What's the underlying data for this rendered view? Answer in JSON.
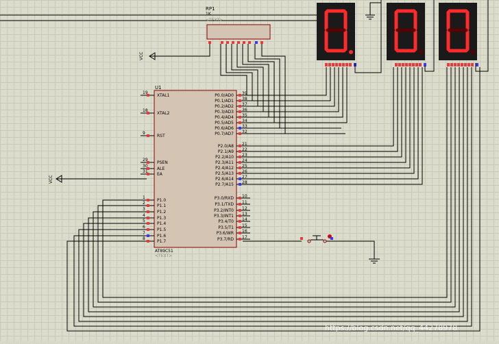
{
  "resistor_pack": {
    "ref": "RP1",
    "value": "1K",
    "text_tag": "<TEXT>"
  },
  "mcu": {
    "ref": "U1",
    "part": "AT89C51",
    "text_tag": "<TEXT>",
    "left_pins": [
      {
        "num": "19",
        "name": "XTAL1"
      },
      {
        "num": "18",
        "name": "XTAL2"
      },
      {
        "num": "9",
        "name": "RST"
      },
      {
        "num": "29",
        "name": "PSEN"
      },
      {
        "num": "30",
        "name": "ALE"
      },
      {
        "num": "31",
        "name": "EA"
      },
      {
        "num": "1",
        "name": "P1.0"
      },
      {
        "num": "2",
        "name": "P1.1"
      },
      {
        "num": "3",
        "name": "P1.2"
      },
      {
        "num": "4",
        "name": "P1.3"
      },
      {
        "num": "5",
        "name": "P1.4"
      },
      {
        "num": "6",
        "name": "P1.5"
      },
      {
        "num": "7",
        "name": "P1.6"
      },
      {
        "num": "8",
        "name": "P1.7"
      }
    ],
    "right_pins_p0": [
      {
        "num": "39",
        "name": "P0.0/AD0"
      },
      {
        "num": "38",
        "name": "P0.1/AD1"
      },
      {
        "num": "37",
        "name": "P0.2/AD2"
      },
      {
        "num": "36",
        "name": "P0.3/AD3"
      },
      {
        "num": "35",
        "name": "P0.4/AD4"
      },
      {
        "num": "34",
        "name": "P0.5/AD5"
      },
      {
        "num": "33",
        "name": "P0.6/AD6"
      },
      {
        "num": "32",
        "name": "P0.7/AD7"
      }
    ],
    "right_pins_p2": [
      {
        "num": "21",
        "name": "P2.0/A8"
      },
      {
        "num": "22",
        "name": "P2.1/A9"
      },
      {
        "num": "23",
        "name": "P2.2/A10"
      },
      {
        "num": "24",
        "name": "P2.3/A11"
      },
      {
        "num": "25",
        "name": "P2.4/A12"
      },
      {
        "num": "26",
        "name": "P2.5/A13"
      },
      {
        "num": "27",
        "name": "P2.6/A14"
      },
      {
        "num": "28",
        "name": "P2.7/A15"
      }
    ],
    "right_pins_p3": [
      {
        "num": "10",
        "name": "P3.0/RXD"
      },
      {
        "num": "11",
        "name": "P3.1/TXD"
      },
      {
        "num": "12",
        "name": "P3.2/INT0"
      },
      {
        "num": "13",
        "name": "P3.3/INT1"
      },
      {
        "num": "14",
        "name": "P3.4/T0"
      },
      {
        "num": "15",
        "name": "P3.5/T1"
      },
      {
        "num": "16",
        "name": "P3.6/WR"
      },
      {
        "num": "17",
        "name": "P3.7/RD"
      }
    ]
  },
  "displays": [
    {
      "digit": "0",
      "dp_on": true
    },
    {
      "digit": "0",
      "dp_on": false
    },
    {
      "digit": "0",
      "dp_on": false
    }
  ],
  "power_labels": {
    "vcc_top": "VCC",
    "vcc_mid": "VCC"
  },
  "watermark": "https://blog.csdn.net/qq_44278978",
  "colors": {
    "segment_on": "#ff2a2a",
    "display_body": "#1a1a1a",
    "display_face": "#5a0000",
    "wire": "#000000",
    "chip_fill": "#d4c4b4",
    "chip_border": "#8a0000",
    "pin_red": "#e83a3a",
    "pin_blue": "#3a3ae8"
  }
}
